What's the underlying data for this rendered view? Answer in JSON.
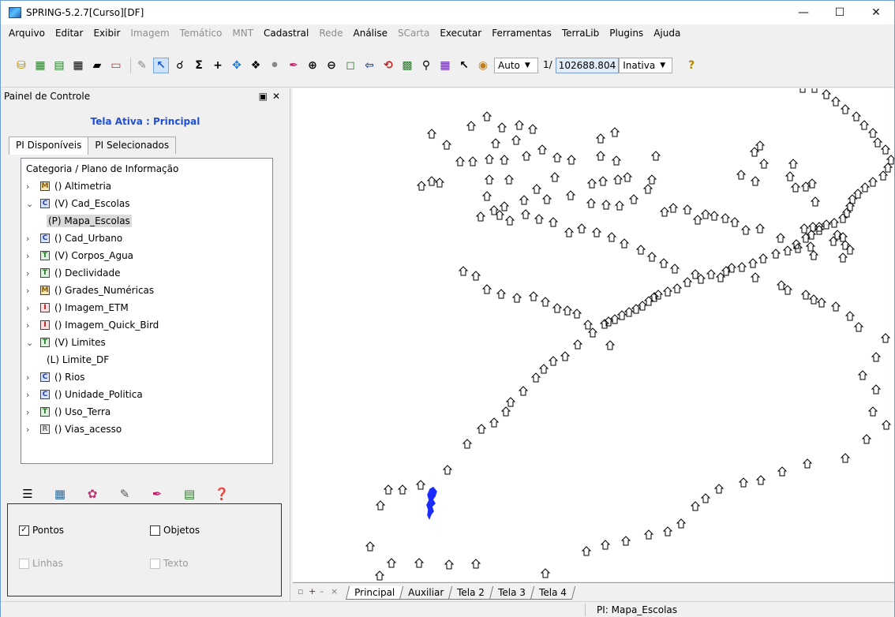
{
  "window": {
    "title": "SPRING-5.2.7[Curso][DF]"
  },
  "menu": [
    {
      "label": "Arquivo",
      "enabled": true
    },
    {
      "label": "Editar",
      "enabled": true
    },
    {
      "label": "Exibir",
      "enabled": true
    },
    {
      "label": "Imagem",
      "enabled": false
    },
    {
      "label": "Temático",
      "enabled": false
    },
    {
      "label": "MNT",
      "enabled": false
    },
    {
      "label": "Cadastral",
      "enabled": true
    },
    {
      "label": "Rede",
      "enabled": false
    },
    {
      "label": "Análise",
      "enabled": true
    },
    {
      "label": "SCarta",
      "enabled": false
    },
    {
      "label": "Executar",
      "enabled": true
    },
    {
      "label": "Ferramentas",
      "enabled": true
    },
    {
      "label": "TerraLib",
      "enabled": true
    },
    {
      "label": "Plugins",
      "enabled": true
    },
    {
      "label": "Ajuda",
      "enabled": true
    }
  ],
  "toolbar": {
    "scale_mode": "Auto",
    "scale_prefix": "1/",
    "scale_value": "102688.804",
    "state": "Inativa"
  },
  "panel": {
    "title": "Painel de Controle",
    "active_screen": "Tela Ativa : Principal",
    "tabs": [
      "PI Disponíveis",
      "PI Selecionados"
    ],
    "tree_header": "Categoria / Plano de Informação",
    "categories": [
      {
        "icon": "M",
        "label": "() Altimetria",
        "expanded": false
      },
      {
        "icon": "C",
        "label": "(V) Cad_Escolas",
        "expanded": true,
        "children": [
          {
            "label": "(P) Mapa_Escolas",
            "selected": true
          }
        ]
      },
      {
        "icon": "C",
        "label": "() Cad_Urbano",
        "expanded": false
      },
      {
        "icon": "T",
        "label": "(V) Corpos_Agua",
        "expanded": false
      },
      {
        "icon": "T",
        "label": "() Declividade",
        "expanded": false
      },
      {
        "icon": "M",
        "label": "() Grades_Numéricas",
        "expanded": false
      },
      {
        "icon": "I",
        "label": "() Imagem_ETM",
        "expanded": false
      },
      {
        "icon": "I",
        "label": "() Imagem_Quick_Bird",
        "expanded": false
      },
      {
        "icon": "T",
        "label": "(V) Limites",
        "expanded": true,
        "children": [
          {
            "label": "(L) Limite_DF",
            "selected": false
          }
        ]
      },
      {
        "icon": "C",
        "label": "() Rios",
        "expanded": false
      },
      {
        "icon": "C",
        "label": "() Unidade_Politica",
        "expanded": false
      },
      {
        "icon": "T",
        "label": "() Uso_Terra",
        "expanded": false
      },
      {
        "icon": "R",
        "label": "() Vias_acesso",
        "expanded": false
      }
    ],
    "options": {
      "pontos": {
        "label": "Pontos",
        "checked": true,
        "enabled": true
      },
      "objetos": {
        "label": "Objetos",
        "checked": false,
        "enabled": true
      },
      "linhas": {
        "label": "Linhas",
        "checked": false,
        "enabled": false
      },
      "texto": {
        "label": "Texto",
        "checked": false,
        "enabled": false
      }
    }
  },
  "screen_tabs": [
    "Principal",
    "Auxiliar",
    "Tela 2",
    "Tela 3",
    "Tela 4"
  ],
  "status": {
    "pi": "PI: Mapa_Escolas"
  },
  "colors": {
    "accent_blue": "#1f4fd4",
    "water_blue": "#1a2cff"
  },
  "icons": {
    "toolbar": [
      "database-icon",
      "edit-image-icon",
      "layers-icon",
      "grid-icon",
      "polygon-icon",
      "window-icon",
      "pencil-icon",
      "cursor-icon",
      "zoom-search-icon",
      "sum-icon",
      "plus-icon",
      "pan-icon",
      "info-icon",
      "tag-icon",
      "draw-icon",
      "zoom-in-icon",
      "zoom-out-icon",
      "zoom-area-icon",
      "back-icon",
      "restore-icon",
      "layer-add-icon",
      "zoom-factor-icon",
      "legend-icon",
      "pointer-icon",
      "palette-icon",
      "help-icon"
    ],
    "panel_tools": [
      "list-icon",
      "table-icon",
      "style-icon",
      "edit-icon",
      "pencil-icon",
      "book-icon",
      "help-icon"
    ]
  }
}
